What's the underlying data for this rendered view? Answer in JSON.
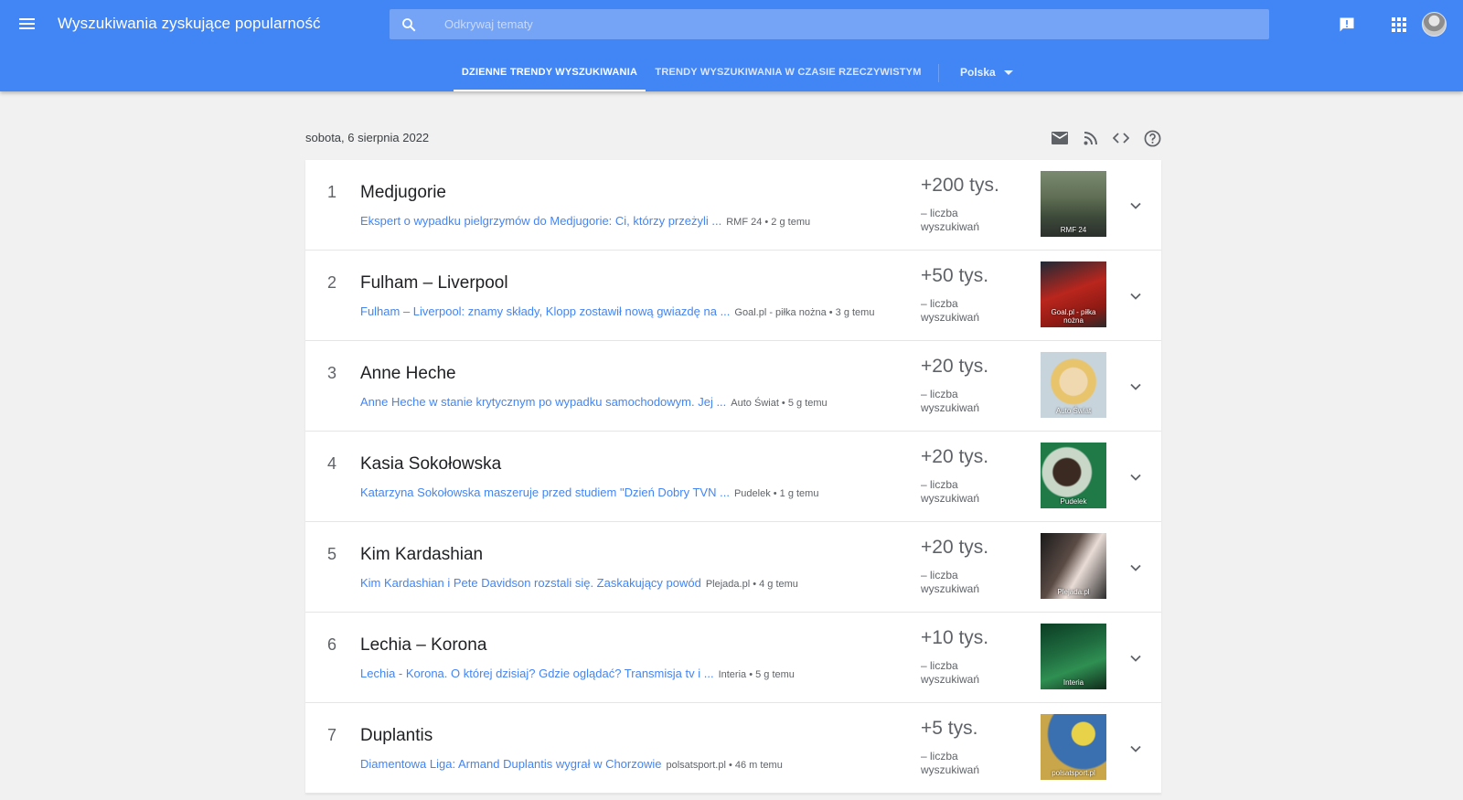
{
  "header": {
    "title": "Wyszukiwania zyskujące popularność",
    "search_placeholder": "Odkrywaj tematy",
    "icons": [
      "menu-icon",
      "search-icon",
      "feedback-icon",
      "apps-grid-icon",
      "avatar"
    ]
  },
  "tabs": {
    "daily": "DZIENNE TRENDY WYSZUKIWANIA",
    "realtime": "TRENDY WYSZUKIWANIA W CZASIE RZECZYWISTYM",
    "country": "Polska"
  },
  "date": "sobota, 6 sierpnia 2022",
  "colors": {
    "header": "#4285f4",
    "link": "#4285f4",
    "background": "#f1f1f1"
  },
  "trends": [
    {
      "rank": "1",
      "term": "Medjugorie",
      "article": "Ekspert o wypadku pielgrzymów do Medjugorie: Ci, którzy przeżyli ...",
      "source": "RMF 24 • 2 g temu",
      "count": "+200 tys.",
      "count_label": "– liczba wyszukiwań",
      "thumb_caption": "RMF 24"
    },
    {
      "rank": "2",
      "term": "Fulham – Liverpool",
      "article": "Fulham – Liverpool: znamy składy, Klopp zostawił nową gwiazdę na ...",
      "source": "Goal.pl - piłka nożna • 3 g temu",
      "count": "+50 tys.",
      "count_label": "– liczba wyszukiwań",
      "thumb_caption": "Goal.pl - piłka nożna"
    },
    {
      "rank": "3",
      "term": "Anne Heche",
      "article": "Anne Heche w stanie krytycznym po wypadku samochodowym. Jej ...",
      "source": "Auto Świat • 5 g temu",
      "count": "+20 tys.",
      "count_label": "– liczba wyszukiwań",
      "thumb_caption": "Auto Świat"
    },
    {
      "rank": "4",
      "term": "Kasia Sokołowska",
      "article": "Katarzyna Sokołowska maszeruje przed studiem \"Dzień Dobry TVN ...",
      "source": "Pudelek • 1 g temu",
      "count": "+20 tys.",
      "count_label": "– liczba wyszukiwań",
      "thumb_caption": "Pudelek"
    },
    {
      "rank": "5",
      "term": "Kim Kardashian",
      "article": "Kim Kardashian i Pete Davidson rozstali się. Zaskakujący powód",
      "source": "Plejada.pl • 4 g temu",
      "count": "+20 tys.",
      "count_label": "– liczba wyszukiwań",
      "thumb_caption": "Plejada.pl"
    },
    {
      "rank": "6",
      "term": "Lechia – Korona",
      "article": "Lechia - Korona. O której dzisiaj? Gdzie oglądać? Transmisja tv i ...",
      "source": "Interia • 5 g temu",
      "count": "+10 tys.",
      "count_label": "– liczba wyszukiwań",
      "thumb_caption": "Interia"
    },
    {
      "rank": "7",
      "term": "Duplantis",
      "article": "Diamentowa Liga: Armand Duplantis wygrał w Chorzowie",
      "source": "polsatsport.pl • 46 m temu",
      "count": "+5 tys.",
      "count_label": "– liczba wyszukiwań",
      "thumb_caption": "polsatsport.pl"
    }
  ]
}
